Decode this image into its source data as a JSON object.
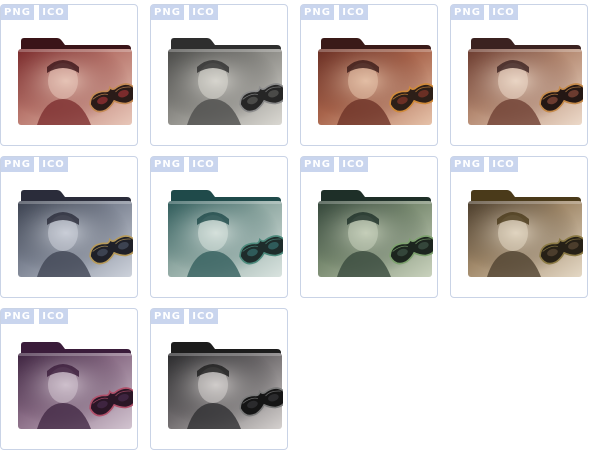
{
  "download_buttons": {
    "png": "PNG",
    "ico": "ICO"
  },
  "icons": [
    {
      "name": "folder-icon-1",
      "palette": {
        "tab": "#3a1418",
        "bg": "#7a2b2c",
        "mid": "#b9786e",
        "light": "#e8c7b9",
        "mask": "#2a1b18",
        "trim": "#c48a54"
      }
    },
    {
      "name": "folder-icon-2",
      "palette": {
        "tab": "#2e2e2e",
        "bg": "#4a4a48",
        "mid": "#8c8b86",
        "light": "#dad8d2",
        "mask": "#262626",
        "trim": "#8b8b8b"
      }
    },
    {
      "name": "folder-icon-3",
      "palette": {
        "tab": "#3a1a18",
        "bg": "#6a2f24",
        "mid": "#a8644b",
        "light": "#e6c2a9",
        "mask": "#2d1f18",
        "trim": "#d08a3a"
      }
    },
    {
      "name": "folder-icon-4",
      "palette": {
        "tab": "#3b2220",
        "bg": "#6b3b2f",
        "mid": "#b58a72",
        "light": "#ecd9c9",
        "mask": "#241714",
        "trim": "#c58a4a"
      }
    },
    {
      "name": "folder-icon-5",
      "palette": {
        "tab": "#2a2c3a",
        "bg": "#3c4250",
        "mid": "#7e8594",
        "light": "#cdd2db",
        "mask": "#1f2028",
        "trim": "#b69a5a"
      }
    },
    {
      "name": "folder-icon-6",
      "palette": {
        "tab": "#1f4a4a",
        "bg": "#2f5b5a",
        "mid": "#8fa8a2",
        "light": "#d9e3df",
        "mask": "#1e2c2b",
        "trim": "#4d8a7c"
      }
    },
    {
      "name": "folder-icon-7",
      "palette": {
        "tab": "#1e2f28",
        "bg": "#34463a",
        "mid": "#7b8c72",
        "light": "#c9d2bd",
        "mask": "#1c251e",
        "trim": "#7da16e"
      }
    },
    {
      "name": "folder-icon-8",
      "palette": {
        "tab": "#4a3a1a",
        "bg": "#4b3d2c",
        "mid": "#a1896a",
        "light": "#e4d8c5",
        "mask": "#262016",
        "trim": "#8b7a45"
      }
    },
    {
      "name": "folder-icon-9",
      "palette": {
        "tab": "#3a1c3a",
        "bg": "#3e2440",
        "mid": "#8a6d86",
        "light": "#d2c4d0",
        "mask": "#2a1626",
        "trim": "#b0506a"
      }
    },
    {
      "name": "folder-icon-10",
      "palette": {
        "tab": "#1c1c1c",
        "bg": "#2b2b2d",
        "mid": "#6e6a6c",
        "light": "#d5d1cf",
        "mask": "#151515",
        "trim": "#7a7a7a"
      }
    }
  ]
}
